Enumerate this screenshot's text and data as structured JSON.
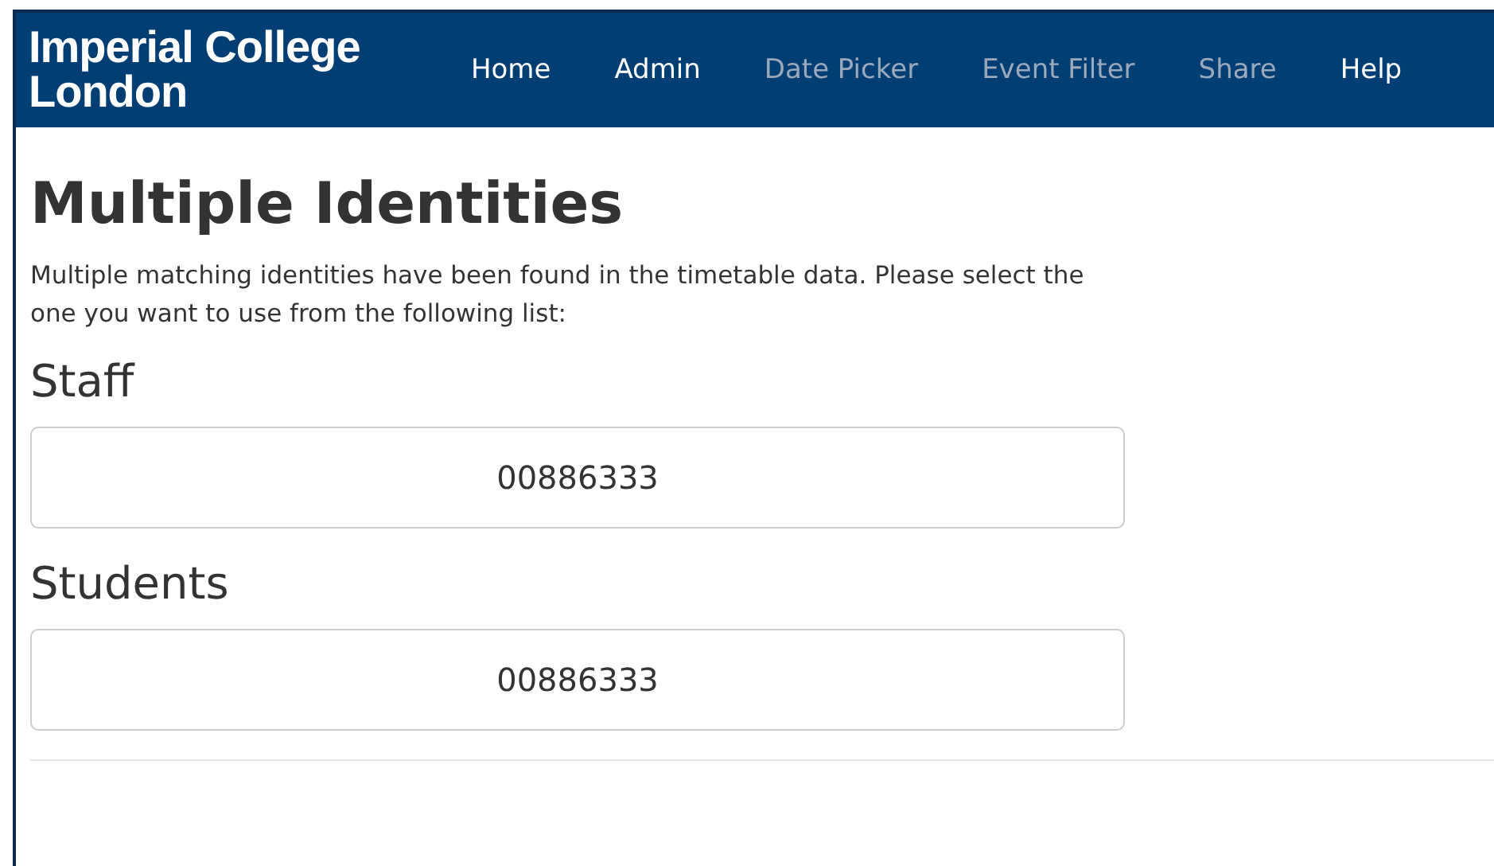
{
  "header": {
    "logo": [
      "Imperial College",
      "London"
    ],
    "nav": [
      {
        "label": "Home",
        "disabled": false
      },
      {
        "label": "Admin",
        "disabled": false
      },
      {
        "label": "Date Picker",
        "disabled": true
      },
      {
        "label": "Event Filter",
        "disabled": true
      },
      {
        "label": "Share",
        "disabled": true
      },
      {
        "label": "Help",
        "disabled": false
      }
    ]
  },
  "title": "Multiple Identities",
  "intro": "Multiple matching identities have been found in the timetable data. Please select the one you want to use from the following list:",
  "groups": [
    {
      "heading": "Staff",
      "options": [
        "00886333"
      ]
    },
    {
      "heading": "Students",
      "options": [
        "00886333"
      ]
    }
  ]
}
